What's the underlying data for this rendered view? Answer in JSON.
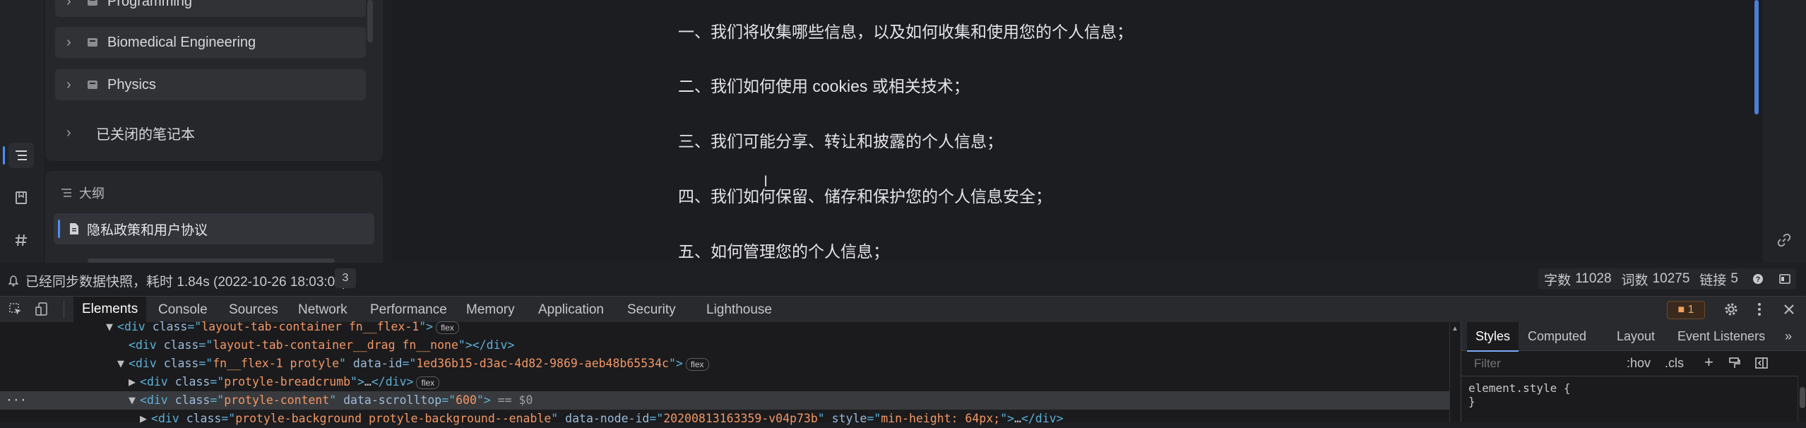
{
  "tree": {
    "items": [
      {
        "label": "Programming"
      },
      {
        "label": "Biomedical Engineering"
      },
      {
        "label": "Physics"
      }
    ],
    "closed_notebooks": "已关闭的笔记本"
  },
  "outline": {
    "title": "大纲",
    "item": "隐私政策和用户协议"
  },
  "editor": {
    "paragraphs": [
      "一、我们将收集哪些信息，以及如何收集和使用您的个人信息；",
      "二、我们如何使用 cookies 或相关技术；",
      "三、我们可能分享、转让和披露的个人信息；",
      "四、我们如何保留、储存和保护您的个人信息安全；",
      "五、如何管理您的个人信息；"
    ]
  },
  "status": {
    "message": "已经同步数据快照，耗时 1.84s (2022-10-26 18:03:01)",
    "badge": "3",
    "chars_label": "字数",
    "chars": "11028",
    "words_label": "词数",
    "words": "10275",
    "links_label": "链接",
    "links": "5"
  },
  "devtools": {
    "tabs": [
      "Elements",
      "Console",
      "Sources",
      "Network",
      "Performance",
      "Memory",
      "Application",
      "Security",
      "Lighthouse"
    ],
    "active_tab": "Elements",
    "issues_count": "1",
    "dom": {
      "l1_tag": "div",
      "l1_attr": "class",
      "l1_val": "layout-tab-container fn__flex-1",
      "l1_pill": "flex",
      "l2_tag": "div",
      "l2_attr": "class",
      "l2_val": "layout-tab-container__drag fn__none",
      "l3_tag": "div",
      "l3_attr": "class",
      "l3_val": "fn__flex-1 protyle",
      "l3_attr2": "data-id",
      "l3_val2": "1ed36b15-d3ac-4d82-9869-aeb48b65534c",
      "l3_pill": "flex",
      "l4_tag": "div",
      "l4_attr": "class",
      "l4_val": "protyle-breadcrumb",
      "l4_pill": "flex",
      "l5_tag": "div",
      "l5_attr": "class",
      "l5_val": "protyle-content",
      "l5_attr2": "data-scrolltop",
      "l5_val2": "600",
      "l5_eq": "== $0",
      "l6_tag": "div",
      "l6_attr": "class",
      "l6_val": "protyle-background protyle-background--enable",
      "l6_attr2": "data-node-id",
      "l6_val2": "20200813163359-v04p73b",
      "l6_attr3": "style",
      "l6_val3": "min-height: 64px;"
    },
    "styles": {
      "tabs": [
        "Styles",
        "Computed",
        "Layout",
        "Event Listeners"
      ],
      "active_tab": "Styles",
      "filter_placeholder": "Filter",
      "hov": ":hov",
      "cls": ".cls",
      "rule_selector": "element.style {",
      "rule_close": "}"
    }
  },
  "colors": {
    "accent": "#4c8df6",
    "devtools_accent": "#7cacf8"
  }
}
